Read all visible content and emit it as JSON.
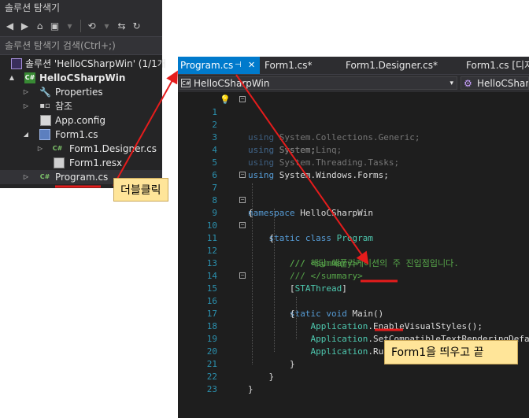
{
  "solution_explorer": {
    "title": "솔루션 탐색기",
    "search_placeholder": "솔루션 탐색기 검색(Ctrl+;)",
    "tree": [
      {
        "label": "솔루션 'HelloCSharpWin' (1/1개",
        "icon": "solution-icon",
        "arrow": ""
      },
      {
        "label": "HelloCSharpWin",
        "icon": "csharp-project-icon",
        "arrow": "▲"
      },
      {
        "label": "Properties",
        "icon": "wrench-icon",
        "arrow": "▷"
      },
      {
        "label": "참조",
        "icon": "references-icon",
        "arrow": "▷"
      },
      {
        "label": "App.config",
        "icon": "config-file-icon",
        "arrow": ""
      },
      {
        "label": "Form1.cs",
        "icon": "form-icon",
        "arrow": "◢"
      },
      {
        "label": "Form1.Designer.cs",
        "icon": "csharp-file-icon",
        "arrow": "▷"
      },
      {
        "label": "Form1.resx",
        "icon": "resource-file-icon",
        "arrow": ""
      },
      {
        "label": "Program.cs",
        "icon": "csharp-file-icon",
        "arrow": "▷",
        "selected": true
      }
    ]
  },
  "editor": {
    "tabs": [
      {
        "label": "Program.cs",
        "active": true,
        "pin": "⊣",
        "close": "✕"
      },
      {
        "label": "Form1.cs*"
      },
      {
        "label": "Form1.Designer.cs*"
      },
      {
        "label": "Form1.cs [디자"
      }
    ],
    "nav_left": "HelloCSharpWin",
    "nav_right": "HelloCSharp",
    "line_numbers": [
      "1",
      "2",
      "3",
      "4",
      "5",
      "6",
      "7",
      "8",
      "9",
      "10",
      "11",
      "12",
      "13",
      "14",
      "15",
      "16",
      "17",
      "18",
      "19",
      "20",
      "21",
      "22",
      "23"
    ]
  },
  "callouts": {
    "double_click": "더블클릭",
    "form1_note": "Form1을 띄우고 끝"
  },
  "colors": {
    "accent": "#007acc",
    "arrow": "#e51c1c",
    "callout_bg": "#ffe599"
  }
}
